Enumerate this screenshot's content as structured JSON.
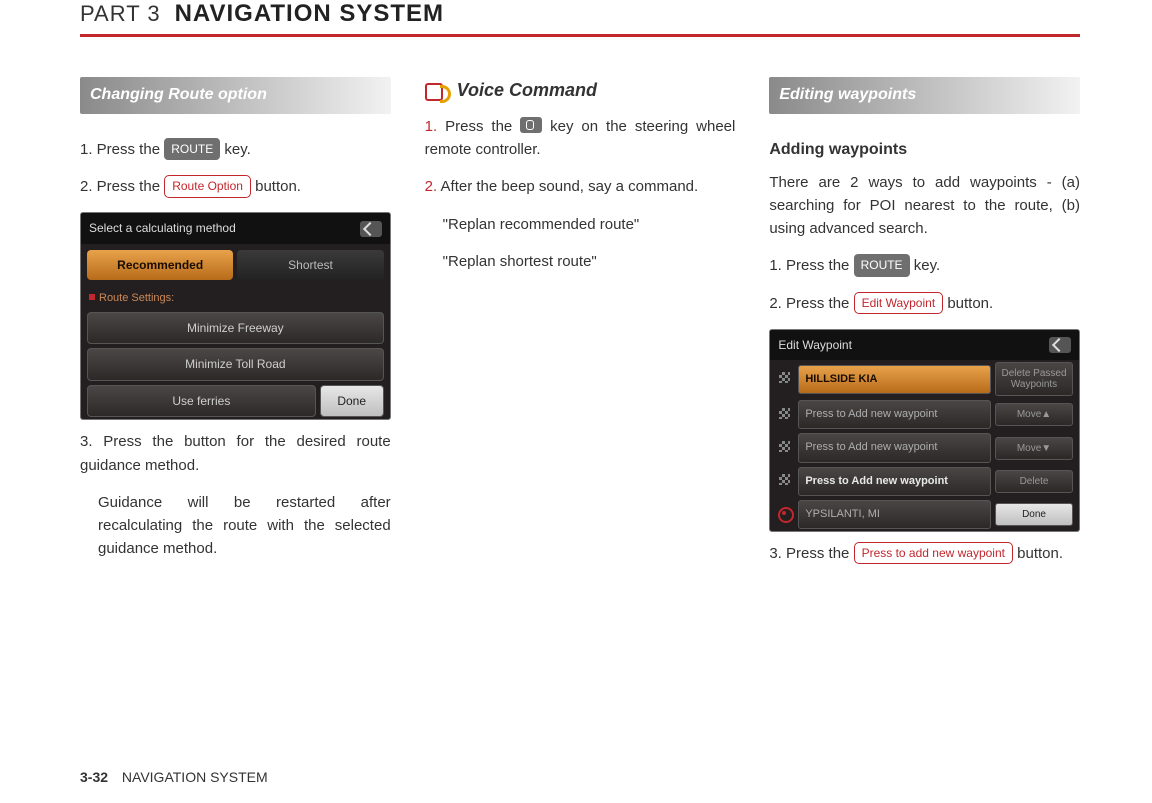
{
  "header": {
    "part": "PART 3",
    "title": "NAVIGATION SYSTEM"
  },
  "col1": {
    "section": "Changing Route option",
    "s1a": "1. Press the ",
    "s1key": "ROUTE",
    "s1b": " key.",
    "s2a": "2. Press the ",
    "s2btn": "Route Option",
    "s2b": " button.",
    "screen": {
      "title": "Select a calculating method",
      "tab1": "Recommended",
      "tab2": "Shortest",
      "label": "Route Settings:",
      "r1": "Minimize Freeway",
      "r2": "Minimize Toll Road",
      "r3": "Use ferries",
      "done": "Done"
    },
    "s3": "3. Press the button for the desired route guidance method.",
    "s3b": "Guidance will be restarted after recalculating the route with the selected guidance method."
  },
  "col2": {
    "voice": "Voice Command",
    "v1a": "1.",
    "v1b": " Press the ",
    "v1c": " key on the steering wheel remote controller.",
    "v2a": "2.",
    "v2b": " After the beep sound, say a command.",
    "v2c": "\"Replan recommended route\"",
    "v2d": "\"Replan shortest route\""
  },
  "col3": {
    "section": "Editing waypoints",
    "sub": "Adding waypoints",
    "intro": "There are 2 ways to add waypoints - (a) searching for POI nearest to the route, (b) using advanced search.",
    "s1a": "1. Press the ",
    "s1key": "ROUTE",
    "s1b": " key.",
    "s2a": "2. Press the ",
    "s2btn": "Edit Waypoint",
    "s2b": " button.",
    "screen": {
      "title": "Edit Waypoint",
      "r1": "HILLSIDE KIA",
      "side1a": "Delete Passed",
      "side1b": "Waypoints",
      "r2": "Press to Add new waypoint",
      "side2": "Move▲",
      "r3": "Press to Add new waypoint",
      "side3": "Move▼",
      "r4": "Press to Add new waypoint",
      "side4": "Delete",
      "r5": "YPSILANTI, MI",
      "side5": "Done"
    },
    "s3a": "3. Press the ",
    "s3btn": "Press to add new waypoint",
    "s3b": " button."
  },
  "footer": {
    "page": "3-32",
    "title": "NAVIGATION SYSTEM"
  }
}
